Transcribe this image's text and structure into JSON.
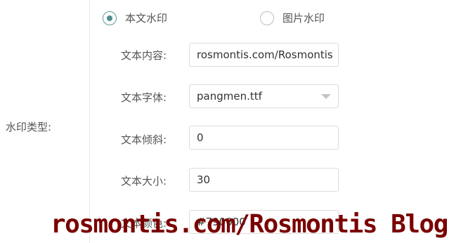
{
  "group_label": "水印类型:",
  "watermark_type": {
    "options": [
      {
        "label": "本文水印",
        "selected": true
      },
      {
        "label": "图片水印",
        "selected": false
      }
    ]
  },
  "fields": {
    "content": {
      "label": "文本内容:",
      "value": "rosmontis.com/Rosmontis B"
    },
    "font": {
      "label": "文本字体:",
      "value": "pangmen.ttf"
    },
    "tilt": {
      "label": "文本倾斜:",
      "value": "0"
    },
    "size": {
      "label": "文本大小:",
      "value": "30"
    },
    "color": {
      "label": "文本颜色:",
      "value": "#790000"
    }
  },
  "overlay_watermark": {
    "text": "rosmontis.com/Rosmontis Blog",
    "color": "#790000"
  },
  "colors": {
    "accent": "#4d8f8c"
  }
}
